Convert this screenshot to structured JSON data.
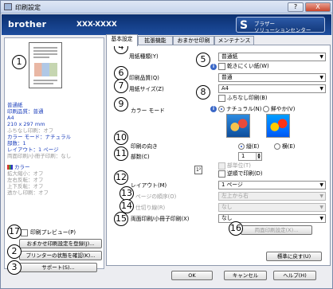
{
  "window": {
    "title": "印刷設定",
    "help_btn": "?",
    "close_btn": "X"
  },
  "banner": {
    "brand": "brother",
    "model": "XXX-XXXX",
    "solutions_line1": "ブラザー",
    "solutions_line2": "ソリューションセンター"
  },
  "left": {
    "summary_blue": [
      "普通紙",
      "印刷品質：普通",
      "A4",
      "210 x 297 mm",
      "カラー モード：ナチュラル",
      "部数：1",
      "レイアウト：1 ページ"
    ],
    "summary_grey": [
      "ふちなし印刷：オフ",
      "両面印刷/小冊子印刷：なし"
    ],
    "color_heading": "カラー",
    "color_items": [
      "拡大縮小：オフ",
      "左右反転：オフ",
      "上下反転：オフ",
      "透かし印刷：オフ"
    ],
    "preview_check_label": "印刷プレビュー(P)",
    "favorites_button": "おまかせ印刷設定を登録(J)...",
    "status_button": "プリンターの状態を確認(K)...",
    "support_button": "サポート(S)..."
  },
  "tabs": [
    "基本設定",
    "拡張機能",
    "おまかせ印刷",
    "メンテナンス"
  ],
  "basic": {
    "media_label": "用紙種類(Y)",
    "media_value": "普通紙",
    "slow_dry_label": "乾きにくい紙(W)",
    "quality_label": "印刷品質(Q)",
    "quality_value": "普通",
    "paper_size_label": "用紙サイズ(Z)",
    "paper_size_value": "A4",
    "borderless_label": "ふちなし印刷(B)",
    "color_mode_label": "カラー モード",
    "natural_label": "ナチュラル(N)",
    "vivid_label": "鮮やか(V)",
    "orientation_label": "印刷の向き",
    "portrait_label": "縦(E)",
    "landscape_label": "横(E)",
    "copies_label": "部数(C)",
    "copies_value": "1",
    "collate_label": "部単位(T)",
    "reverse_label": "逆順で印刷(D)",
    "layout_label": "レイアウト(M)",
    "layout_value": "1 ページ",
    "page_order_label": "ページの順序(O)",
    "page_order_value": "左上から右",
    "border_line_label": "仕切り線(R)",
    "border_line_value": "なし",
    "duplex_label": "両面印刷/小冊子印刷(X)",
    "duplex_value": "なし",
    "duplex_settings_button": "両面印刷設定(X)...",
    "defaults_button": "標準に戻す(U)"
  },
  "footer": {
    "ok": "OK",
    "cancel": "キャンセル",
    "help": "ヘルプ(H)"
  },
  "callouts": [
    "1",
    "2",
    "3",
    "4",
    "5",
    "6",
    "7",
    "8",
    "9",
    "10",
    "11",
    "12",
    "13",
    "14",
    "15",
    "16",
    "17"
  ],
  "colors": {
    "banner": "#0b2f6f",
    "summary_text": "#1a3dbb",
    "disabled_text": "#9a9a9a"
  }
}
